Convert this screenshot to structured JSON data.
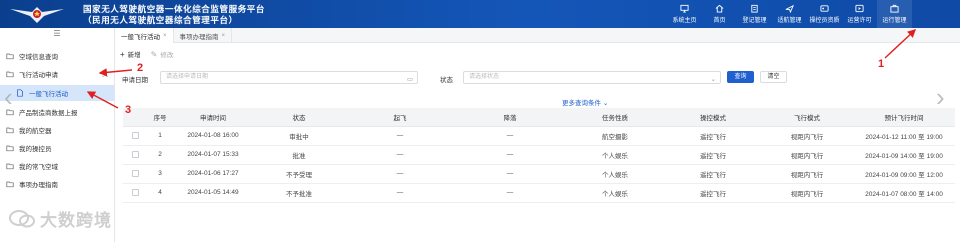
{
  "header": {
    "title_line1": "国家无人驾驶航空器一体化综合监管服务平台",
    "title_line2": "（民用无人驾驶航空器综合管理平台）",
    "nav": [
      {
        "label": "系统主页",
        "icon": "monitor-icon"
      },
      {
        "label": "首页",
        "icon": "home-icon"
      },
      {
        "label": "登记管理",
        "icon": "clipboard-icon"
      },
      {
        "label": "适航管理",
        "icon": "plane-icon"
      },
      {
        "label": "操控员资质",
        "icon": "card-icon"
      },
      {
        "label": "运营许可",
        "icon": "play-icon"
      },
      {
        "label": "运行管理",
        "icon": "briefcase-icon"
      }
    ]
  },
  "sidebar": {
    "toggle": "☰",
    "items": [
      {
        "label": "空域信息查询"
      },
      {
        "label": "飞行活动申请"
      },
      {
        "label": "一般飞行活动"
      },
      {
        "label": "产品制造商数据上报"
      },
      {
        "label": "我的航空器"
      },
      {
        "label": "我的操控员"
      },
      {
        "label": "我的常飞空域"
      },
      {
        "label": "事项办理指南"
      }
    ]
  },
  "tabs": [
    {
      "label": "一般飞行活动"
    },
    {
      "label": "事项办理指南"
    }
  ],
  "toolbar": {
    "add_label": "新增",
    "edit_label": "修改"
  },
  "search": {
    "date_label": "申请日期",
    "date_placeholder": "请选择申请日期",
    "status_label": "状态",
    "status_placeholder": "请选择状态",
    "query_label": "查询",
    "reset_label": "清空",
    "more_label": "更多查询条件"
  },
  "table": {
    "headers": [
      "",
      "序号",
      "申请时间",
      "状态",
      "起飞",
      "降落",
      "任务性质",
      "操控模式",
      "飞行模式",
      "预计飞行时间"
    ],
    "rows": [
      {
        "no": "1",
        "time": "2024-01-08 16:00",
        "status": "审批中",
        "takeoff": "—",
        "landing": "—",
        "task": "航空摄影",
        "control": "遥控飞行",
        "flight": "视距内飞行",
        "plan": "2024-01-12 11:00 至 19:00"
      },
      {
        "no": "2",
        "time": "2024-01-07 15:33",
        "status": "批准",
        "takeoff": "—",
        "landing": "—",
        "task": "个人娱乐",
        "control": "遥控飞行",
        "flight": "视距内飞行",
        "plan": "2024-01-09 14:00 至 19:00"
      },
      {
        "no": "3",
        "time": "2024-01-06 17:27",
        "status": "不予受理",
        "takeoff": "—",
        "landing": "—",
        "task": "个人娱乐",
        "control": "遥控飞行",
        "flight": "视距内飞行",
        "plan": "2024-01-09 09:00 至 12:00"
      },
      {
        "no": "4",
        "time": "2024-01-05 14:49",
        "status": "不予批准",
        "takeoff": "—",
        "landing": "—",
        "task": "个人娱乐",
        "control": "遥控飞行",
        "flight": "视距内飞行",
        "plan": "2024-01-07 08:00 至 14:00"
      }
    ]
  },
  "annotations": [
    "1",
    "2",
    "3"
  ],
  "watermark": "大数跨境",
  "colors": {
    "header": "#1456b8",
    "accent": "#1f5fd0",
    "annotation": "#e02020",
    "selected_bg": "#d5e6fb"
  }
}
